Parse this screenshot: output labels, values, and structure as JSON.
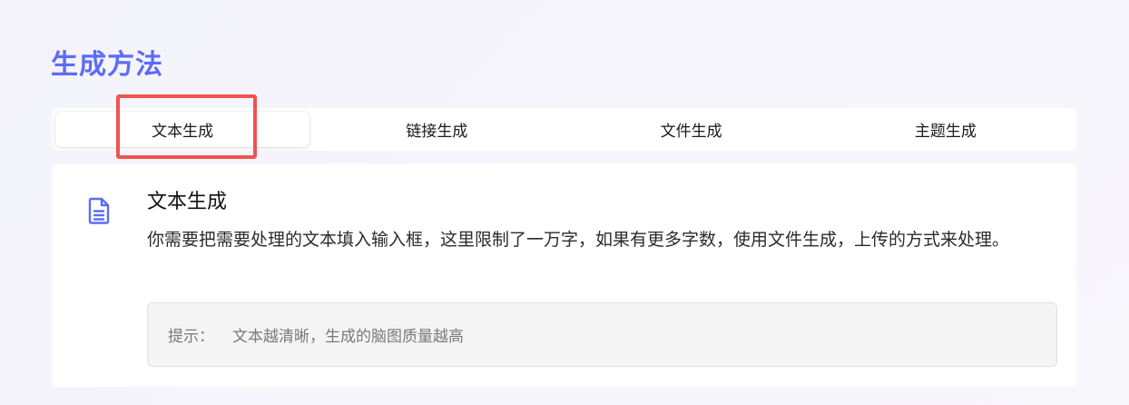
{
  "section": {
    "title": "生成方法"
  },
  "tabs": [
    {
      "label": "文本生成",
      "active": true
    },
    {
      "label": "链接生成",
      "active": false
    },
    {
      "label": "文件生成",
      "active": false
    },
    {
      "label": "主题生成",
      "active": false
    }
  ],
  "card": {
    "icon": "document-icon",
    "title": "文本生成",
    "description": "你需要把需要处理的文本填入输入框，这里限制了一万字，如果有更多字数，使用文件生成，上传的方式来处理。",
    "hint_label": "提示：",
    "hint_text": "文本越清晰，生成的脑图质量越高"
  },
  "colors": {
    "accent": "#5b6df5",
    "highlight": "#ef5450",
    "hint_bg": "#f4f4f4"
  }
}
